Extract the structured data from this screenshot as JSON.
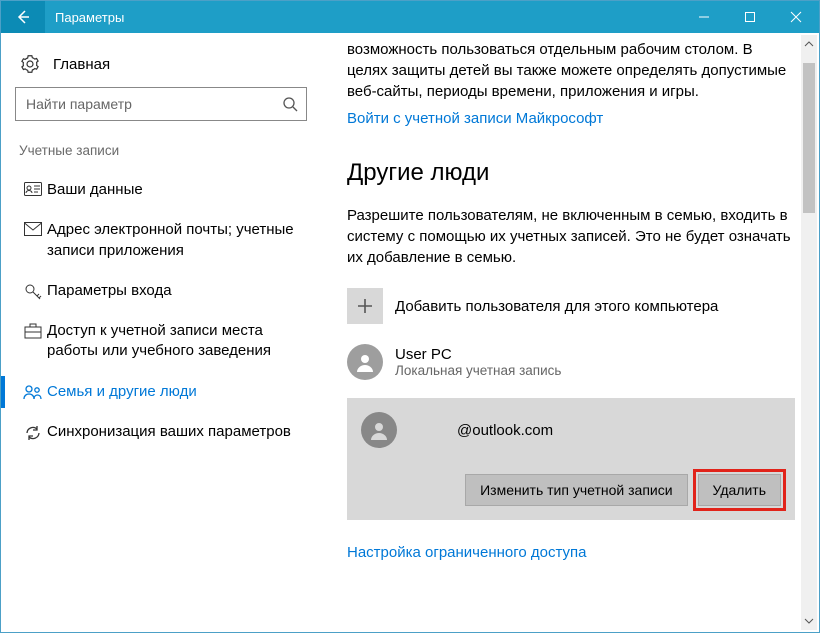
{
  "window": {
    "title": "Параметры"
  },
  "sidebar": {
    "home": "Главная",
    "search_placeholder": "Найти параметр",
    "section": "Учетные записи",
    "items": [
      {
        "label": "Ваши данные"
      },
      {
        "label": "Адрес электронной почты; учетные записи приложения"
      },
      {
        "label": "Параметры входа"
      },
      {
        "label": "Доступ к учетной записи места работы или учебного заведения"
      },
      {
        "label": "Семья и другие люди"
      },
      {
        "label": "Синхронизация ваших параметров"
      }
    ]
  },
  "main": {
    "intro_para": "возможность пользоваться отдельным рабочим столом. В целях защиты детей вы также можете определять допустимые веб-сайты, периоды времени, приложения и игры.",
    "signin_link": "Войти с учетной записи Майкрософт",
    "heading": "Другие люди",
    "desc": "Разрешите пользователям, не включенным в семью, входить в систему с помощью их учетных записей. Это не будет означать их добавление в семью.",
    "add_label": "Добавить пользователя для этого компьютера",
    "user1": {
      "name": "User PC",
      "sub": "Локальная учетная запись"
    },
    "user2": {
      "email": "@outlook.com"
    },
    "btn_change": "Изменить тип учетной записи",
    "btn_delete": "Удалить",
    "restricted_link": "Настройка ограниченного доступа"
  }
}
